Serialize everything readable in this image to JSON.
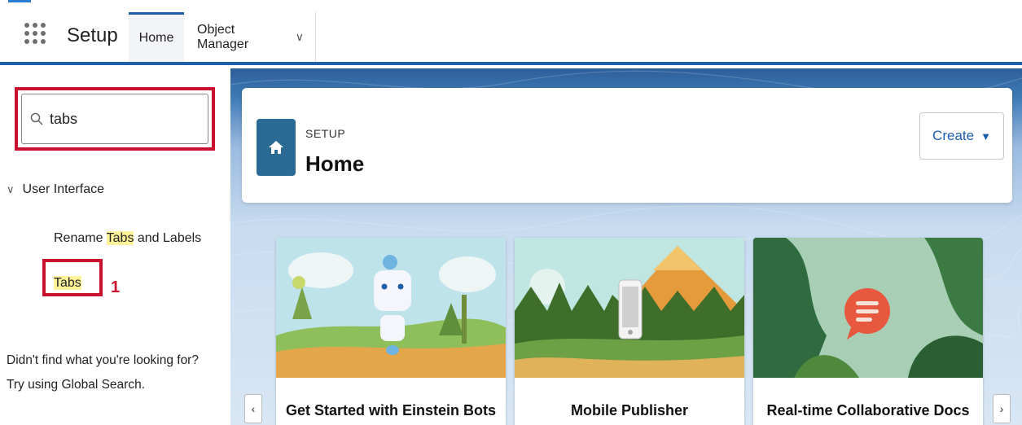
{
  "app": {
    "name": "Setup"
  },
  "nav": {
    "tabs": [
      {
        "label": "Home"
      },
      {
        "label": "Object Manager"
      }
    ]
  },
  "sidebar": {
    "search_value": "tabs",
    "group_label": "User Interface",
    "items": [
      {
        "label_prefix": "Rename ",
        "label_highlight": "Tabs",
        "label_suffix": " and Labels"
      },
      {
        "label_highlight": "Tabs"
      }
    ],
    "step_marker": "1",
    "help_line1": "Didn't find what you're looking for?",
    "help_line2": "Try using Global Search."
  },
  "header": {
    "eyebrow": "SETUP",
    "title": "Home",
    "create_label": "Create"
  },
  "cards": [
    {
      "title": "Get Started with Einstein Bots"
    },
    {
      "title": "Mobile Publisher"
    },
    {
      "title": "Real-time Collaborative Docs"
    }
  ],
  "colors": {
    "accent": "#1f5ea8",
    "highlight_red": "#c9102f",
    "search_highlight": "#fff39a",
    "home_tile": "#2a6a94"
  },
  "icons": [
    "app-launcher-icon",
    "search-icon",
    "chevron-down-icon",
    "home-icon",
    "caret-down-icon",
    "chevron-left-icon",
    "chevron-right-icon"
  ]
}
